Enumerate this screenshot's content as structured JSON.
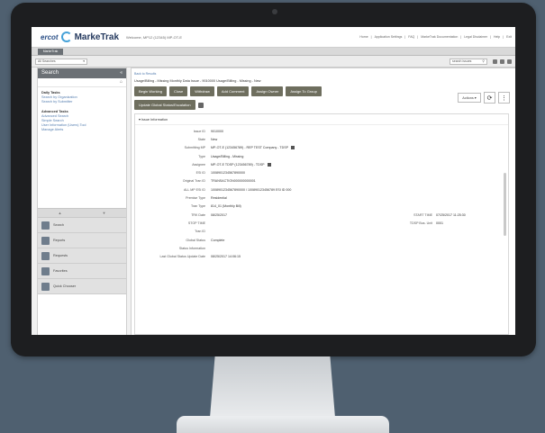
{
  "app": {
    "brand": "ercot",
    "product": "MarkeTrak",
    "welcome": "Welcome, MP12 (12345) MP-OT-E",
    "header_links": [
      "Home",
      "|",
      "Application Settings",
      "|",
      "FAQ",
      "|",
      "MarkeTrak Documentation",
      "|",
      "Legal Disclaimer",
      "|",
      "Help",
      "|",
      "Exit"
    ]
  },
  "tabs": [
    {
      "label": "MarkeTrak",
      "active": true
    }
  ],
  "toolbar": {
    "view_select": "All Searches",
    "search_placeholder": "search issues",
    "icons": [
      "filter-icon",
      "user-icon",
      "home-icon"
    ]
  },
  "sidebar": {
    "title": "Search",
    "sections": [
      {
        "title": "Daily Tasks",
        "links": [
          "Search by Organization",
          "Search by Submitter"
        ]
      },
      {
        "title": "Advanced Tasks",
        "links": [
          "Advanced Search",
          "Simple Search",
          "User Information (Users) Tool",
          "Manage Alerts"
        ]
      }
    ],
    "nav_items": [
      {
        "label": "Search",
        "icon": "search-icon"
      },
      {
        "label": "Reports",
        "icon": "reports-icon"
      },
      {
        "label": "Requests",
        "icon": "requests-icon"
      },
      {
        "label": "Favorites",
        "icon": "favorites-icon"
      },
      {
        "label": "Quick Chooser",
        "icon": "chooser-icon"
      }
    ]
  },
  "main": {
    "breadcrumb": "Back to Results",
    "issue_title": "Usage/Billing - Missing Monthly Data Issue - 9010000 Usage/Billing - Missing - New",
    "buttons_row1": [
      "Begin Working",
      "Close",
      "Withdraw",
      "Add Comment",
      "Assign Owner",
      "Assign To Group"
    ],
    "buttons_row2": [
      "Update Global Status/Escalation"
    ],
    "actions_label": "Actions ▾",
    "panel_title": "Issue Information",
    "fields": [
      {
        "label": "Issue ID",
        "value": "9010000"
      },
      {
        "label": "State",
        "value": "New"
      },
      {
        "label": "Submitting MP",
        "value": "MP-OT-E (123456789) - REP TEST Company - TDSP",
        "icon": true
      },
      {
        "label": "Type",
        "value": "Usage/Billing - Missing"
      },
      {
        "label": "Assignee",
        "value": "MP-OT-E TDSP (123456789) - TDSP",
        "icon": true
      },
      {
        "label": "ESI ID",
        "value": "1008901234567890000"
      },
      {
        "label": "Original Tran ID",
        "value": "TRANSACTION000000000001"
      },
      {
        "label": "ALL MP ESI ID",
        "value": "1008901234567890000 / 100890123456789 ESI ID 000"
      },
      {
        "label": "Premise Type",
        "value": "Residential"
      },
      {
        "label": "Tran Type",
        "value": "814_01 (Monthly Bill)"
      },
      {
        "label": "TRK Date",
        "value": "08/25/2017",
        "right_label": "START TIME",
        "right_value": "07/25/2017 11:25:30"
      },
      {
        "label": "STOP TIME",
        "value": "",
        "right_label": "TDSP Bus. Unit",
        "right_value": "0001"
      },
      {
        "label": "Tran ID",
        "value": ""
      },
      {
        "label": "Global Status",
        "value": "Complete"
      },
      {
        "label": "Status Information",
        "value": ""
      },
      {
        "label": "Last Global Status Update Date",
        "value": "08/25/2017 14:06:15"
      }
    ]
  },
  "colors": {
    "background": "#4f6070",
    "bezel": "#1d1e20",
    "button": "#6e6e5e",
    "sidebar_header": "#6b7075",
    "link": "#567fb0"
  }
}
